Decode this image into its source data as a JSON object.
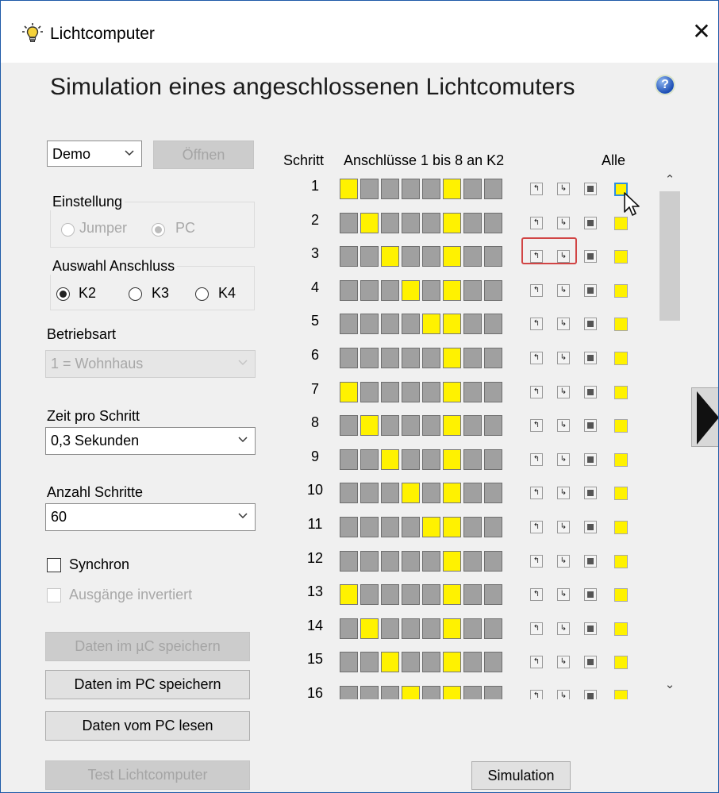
{
  "window": {
    "title": "Lichtcomputer",
    "close_glyph": "✕",
    "app_icon": "lightbulb-icon"
  },
  "heading": "Simulation eines angeschlossenen Lichtcomuters",
  "help_icon": "?",
  "left": {
    "mode_select": {
      "value": "Demo"
    },
    "open_button": "Öffnen",
    "einstellung": {
      "label": "Einstellung",
      "options": [
        "Jumper",
        "PC"
      ],
      "selected": "PC"
    },
    "anschluss": {
      "label": "Auswahl Anschluss",
      "options": [
        "K2",
        "K3",
        "K4"
      ],
      "selected": "K2"
    },
    "betriebsart": {
      "label": "Betriebsart",
      "value": "1 = Wohnhaus"
    },
    "zeit": {
      "label": "Zeit pro Schritt",
      "value": "0,3 Sekunden"
    },
    "anzahl": {
      "label": "Anzahl Schritte",
      "value": "60"
    },
    "synchron": {
      "label": "Synchron",
      "checked": false
    },
    "invertiert": {
      "label": "Ausgänge invertiert",
      "checked": false
    },
    "buttons": {
      "save_uc": "Daten im µC speichern",
      "save_pc": "Daten im PC speichern",
      "load_pc": "Daten vom PC lesen",
      "test": "Test Lichtcomputer"
    }
  },
  "grid": {
    "col_schritt": "Schritt",
    "col_anschluesse": "Anschlüsse 1 bis 8 an K2",
    "col_alle": "Alle",
    "rows": [
      {
        "step": "1",
        "on": [
          1,
          6
        ]
      },
      {
        "step": "2",
        "on": [
          2,
          6
        ]
      },
      {
        "step": "3",
        "on": [
          3,
          6
        ]
      },
      {
        "step": "4",
        "on": [
          4,
          6
        ]
      },
      {
        "step": "5",
        "on": [
          5,
          6
        ]
      },
      {
        "step": "6",
        "on": [
          6
        ]
      },
      {
        "step": "7",
        "on": [
          1,
          6
        ]
      },
      {
        "step": "8",
        "on": [
          2,
          6
        ]
      },
      {
        "step": "9",
        "on": [
          3,
          6
        ]
      },
      {
        "step": "10",
        "on": [
          4,
          6
        ]
      },
      {
        "step": "11",
        "on": [
          5,
          6
        ]
      },
      {
        "step": "12",
        "on": [
          6
        ]
      },
      {
        "step": "13",
        "on": [
          1,
          6
        ]
      },
      {
        "step": "14",
        "on": [
          2,
          6
        ]
      },
      {
        "step": "15",
        "on": [
          3,
          6
        ]
      },
      {
        "step": "16",
        "on": [
          4,
          6
        ]
      }
    ]
  },
  "simulation_button": "Simulation",
  "colors": {
    "on": "#fff200",
    "off": "#a0a0a0",
    "accent": "#2f8ee0",
    "highlight": "#d14444"
  }
}
